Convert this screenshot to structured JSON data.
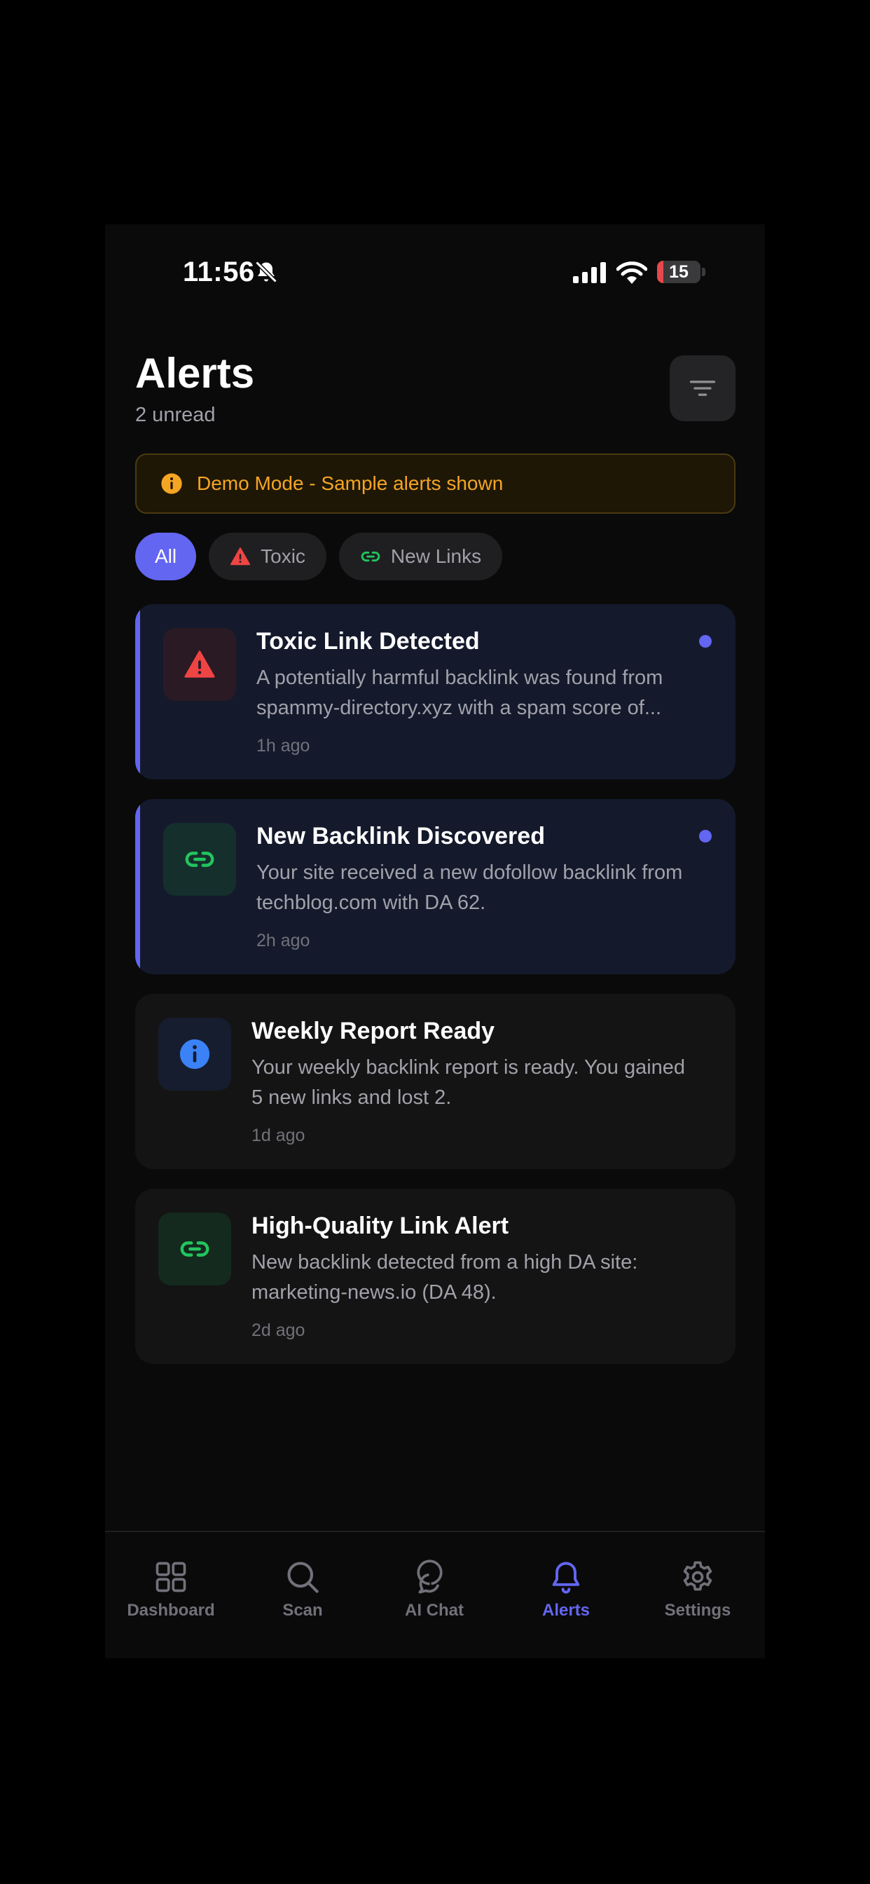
{
  "status_bar": {
    "time": "11:56",
    "battery": "15",
    "battery_level": 0.15
  },
  "header": {
    "title": "Alerts",
    "unread_count": "2 unread"
  },
  "demo_banner": {
    "text": "Demo Mode - Sample alerts shown"
  },
  "filters": [
    {
      "label": "All",
      "active": true
    },
    {
      "label": "Toxic",
      "icon": "warning-icon"
    },
    {
      "label": "New Links",
      "icon": "link-icon"
    }
  ],
  "alerts": [
    {
      "title": "Toxic Link Detected",
      "description": "A potentially harmful backlink was found from spammy-directory.xyz with a spam score of...",
      "time": "1h ago",
      "icon": "warning-icon",
      "unread": true
    },
    {
      "title": "New Backlink Discovered",
      "description": "Your site received a new dofollow backlink from techblog.com with DA 62.",
      "time": "2h ago",
      "icon": "link-icon",
      "unread": true
    },
    {
      "title": "Weekly Report Ready",
      "description": "Your weekly backlink report is ready. You gained 5 new links and lost 2.",
      "time": "1d ago",
      "icon": "info-icon",
      "unread": false
    },
    {
      "title": "High-Quality Link Alert",
      "description": "New backlink detected from a high DA site: marketing-news.io (DA 48).",
      "time": "2d ago",
      "icon": "link-icon",
      "unread": false
    }
  ],
  "tabs": [
    {
      "label": "Dashboard",
      "icon": "grid-icon"
    },
    {
      "label": "Scan",
      "icon": "search-icon"
    },
    {
      "label": "AI Chat",
      "icon": "chat-icon"
    },
    {
      "label": "Alerts",
      "icon": "bell-icon",
      "active": true
    },
    {
      "label": "Settings",
      "icon": "gear-icon"
    }
  ],
  "colors": {
    "accent": "#6366f1",
    "toxic": "#ef4444",
    "link": "#22c55e",
    "info": "#3b82f6",
    "warning": "#f5a524"
  }
}
